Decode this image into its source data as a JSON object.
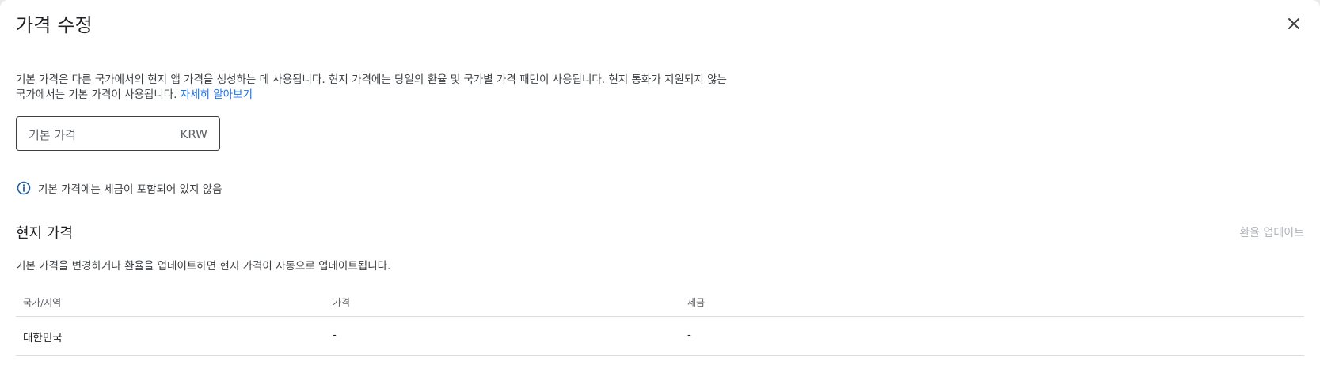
{
  "dialog": {
    "title": "가격 수정",
    "close_icon": "close-icon"
  },
  "description": {
    "text": "기본 가격은 다른 국가에서의 현지 앱 가격을 생성하는 데 사용됩니다. 현지 가격에는 당일의 환율 및 국가별 가격 패턴이 사용됩니다. 현지 통화가 지원되지 않는 국가에서는 기본 가격이 사용됩니다. ",
    "learn_more": "자세히 알아보기"
  },
  "base_price": {
    "placeholder": "기본 가격",
    "currency": "KRW",
    "value": ""
  },
  "tax_notice": {
    "icon": "info-icon",
    "text": "기본 가격에는 세금이 포함되어 있지 않음"
  },
  "local_prices": {
    "title": "현지 가격",
    "update_rate_label": "환율 업데이트",
    "description": "기본 가격을 변경하거나 환율을 업데이트하면 현지 가격이 자동으로 업데이트됩니다.",
    "columns": [
      "국가/지역",
      "가격",
      "세금"
    ],
    "rows": [
      [
        "대한민국",
        "-",
        "-"
      ]
    ]
  },
  "colors": {
    "link": "#1a73e8",
    "disabled_text": "#b0b3b8"
  }
}
